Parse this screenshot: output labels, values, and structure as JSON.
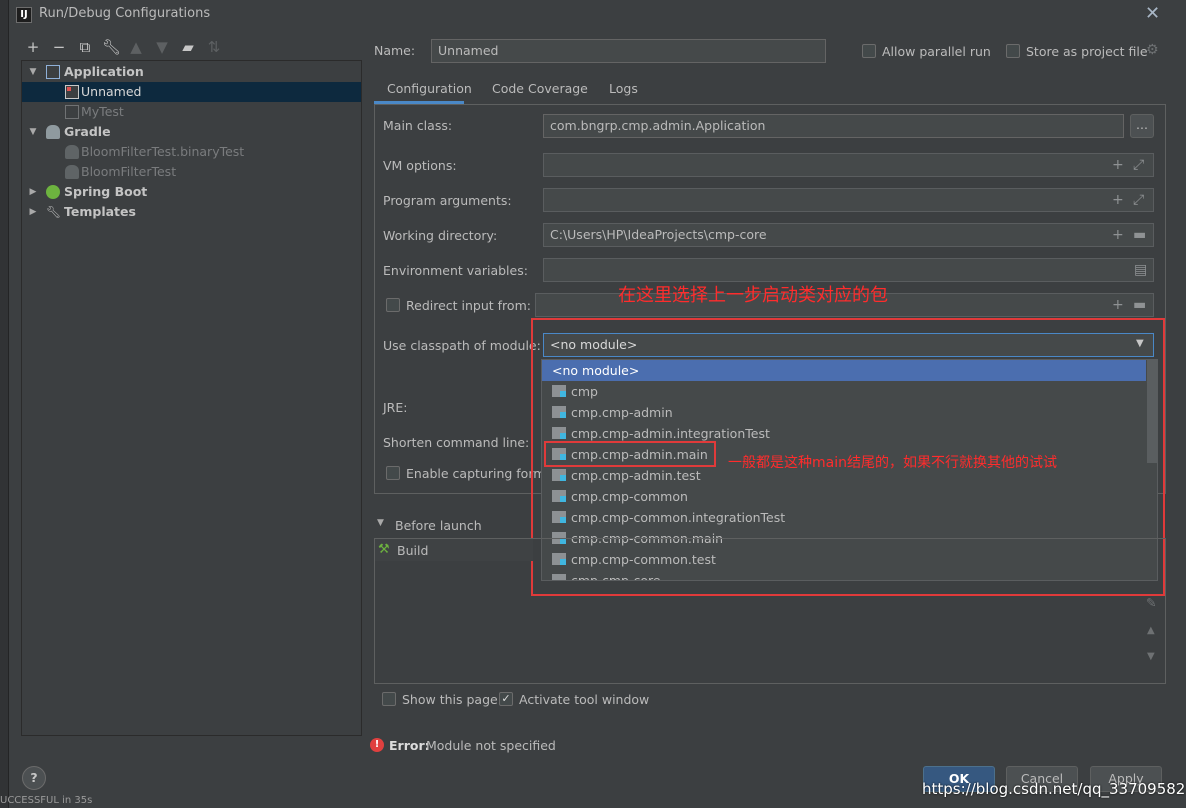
{
  "window": {
    "title": "Run/Debug Configurations",
    "icon": "intellij-icon"
  },
  "toolbar": {
    "icons": [
      "add-icon",
      "remove-icon",
      "copy-icon",
      "wrench-icon",
      "move-up-icon",
      "move-down-icon",
      "new-folder-icon",
      "sort-icon"
    ]
  },
  "tree": {
    "items": [
      {
        "label": "Application",
        "level": 0,
        "expanded": true,
        "bold": true,
        "icon": "application-icon"
      },
      {
        "label": "Unnamed",
        "level": 1,
        "selected": true,
        "icon": "app-config-icon"
      },
      {
        "label": "MyTest",
        "level": 1,
        "dim": true,
        "icon": "app-config-icon"
      },
      {
        "label": "Gradle",
        "level": 0,
        "expanded": true,
        "bold": true,
        "icon": "gradle-icon"
      },
      {
        "label": "BloomFilterTest.binaryTest",
        "level": 1,
        "dim": true,
        "icon": "gradle-icon"
      },
      {
        "label": "BloomFilterTest",
        "level": 1,
        "dim": true,
        "icon": "gradle-icon"
      },
      {
        "label": "Spring Boot",
        "level": 0,
        "expanded": false,
        "bold": true,
        "icon": "spring-boot-icon"
      },
      {
        "label": "Templates",
        "level": 0,
        "expanded": false,
        "bold": true,
        "icon": "wrench-icon"
      }
    ]
  },
  "name": {
    "label": "Name:",
    "value": "Unnamed"
  },
  "allow_parallel": {
    "label": "Allow parallel run",
    "checked": false
  },
  "store_project": {
    "label": "Store as project file",
    "checked": false
  },
  "tabs": [
    {
      "label": "Configuration",
      "active": true
    },
    {
      "label": "Code Coverage",
      "active": false
    },
    {
      "label": "Logs",
      "active": false
    }
  ],
  "form": {
    "main_class": {
      "label": "Main class:",
      "value": "com.bngrp.cmp.admin.Application",
      "button": "..."
    },
    "vm_options": {
      "label": "VM options:",
      "value": ""
    },
    "program_args": {
      "label": "Program arguments:",
      "value": ""
    },
    "working_dir": {
      "label": "Working directory:",
      "value": "C:\\Users\\HP\\IdeaProjects\\cmp-core"
    },
    "env_vars": {
      "label": "Environment variables:",
      "value": ""
    },
    "redirect_input": {
      "label": "Redirect input from:",
      "checked": false,
      "value": ""
    },
    "classpath": {
      "label": "Use classpath of module:",
      "value": "<no module>"
    },
    "jre": {
      "label": "JRE:"
    },
    "shorten": {
      "label": "Shorten command line:"
    },
    "capturing": {
      "label": "Enable capturing form",
      "checked": false
    }
  },
  "module_dropdown": {
    "items": [
      {
        "label": "<no module>",
        "selected": true,
        "folder": false
      },
      {
        "label": "cmp",
        "folder": true
      },
      {
        "label": "cmp.cmp-admin",
        "folder": true
      },
      {
        "label": "cmp.cmp-admin.integrationTest",
        "folder": true
      },
      {
        "label": "cmp.cmp-admin.main",
        "folder": true
      },
      {
        "label": "cmp.cmp-admin.test",
        "folder": true
      },
      {
        "label": "cmp.cmp-common",
        "folder": true
      },
      {
        "label": "cmp.cmp-common.integrationTest",
        "folder": true
      },
      {
        "label": "cmp.cmp-common.main",
        "folder": true
      },
      {
        "label": "cmp.cmp-common.test",
        "folder": true
      },
      {
        "label": "cmp.cmp-core",
        "folder": true
      }
    ]
  },
  "annotations": {
    "top": "在这里选择上一步启动类对应的包",
    "side": "一般都是这种main结尾的，如果不行就换其他的试试",
    "color": "#ff2c2c"
  },
  "before_launch": {
    "label": "Before launch",
    "items": [
      {
        "label": "Build",
        "icon": "hammer-icon"
      }
    ]
  },
  "show_page": {
    "label": "Show this page",
    "checked": false
  },
  "activate_tool": {
    "label": "Activate tool window",
    "checked": true
  },
  "error": {
    "prefix": "Error:",
    "message": "Module not specified"
  },
  "buttons": {
    "ok": "OK",
    "cancel": "Cancel",
    "apply": "Apply"
  },
  "watermark": "https://blog.csdn.net/qq_33709582",
  "background_text": "UCCESSFUL in 35s",
  "colors": {
    "selection": "#4b6eaf",
    "tree_selection": "#0d293e",
    "tab_underline": "#4a88c7",
    "error": "#e0403f"
  }
}
